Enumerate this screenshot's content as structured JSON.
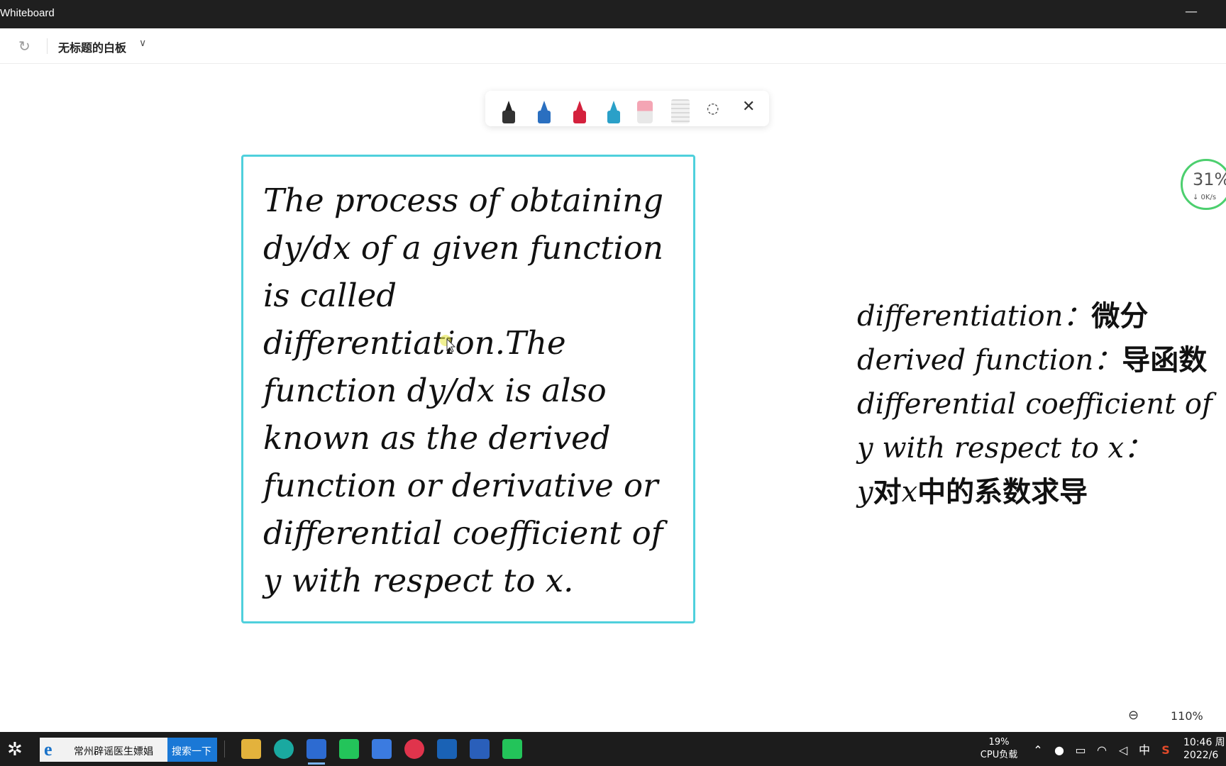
{
  "window": {
    "title": "Whiteboard",
    "minimize": "—"
  },
  "topbar": {
    "doc_title": "无标题的白板",
    "redo_glyph": "↻",
    "chevron": "∨"
  },
  "toolbar": {
    "pens": [
      {
        "name": "black-pen",
        "color": "#222222"
      },
      {
        "name": "blue-pen",
        "color": "#2a6fc0"
      },
      {
        "name": "red-pen",
        "color": "#d4213d"
      },
      {
        "name": "highlighter",
        "color": "#2aa0c8"
      }
    ],
    "lasso_glyph": "◌",
    "close_glyph": "✕"
  },
  "card": {
    "text": "The process of obtaining dy/dx of a given function is called differentiation.The function dy/dx is also known as the derived function or derivative or differential coefficient of y with respect to x."
  },
  "notes": {
    "line1_en": "differentiation：",
    "line1_zh": "微分",
    "line2_en": "derived function：",
    "line2_zh": "导函数",
    "line3": "differential coefficient of",
    "line4": "y with respect to x：",
    "line5_y": "y",
    "line5_zh_a": "对",
    "line5_x": "x",
    "line5_zh_b": "中的系数求导"
  },
  "speed_widget": {
    "percent": "31%",
    "rate": "↓ 0K/s"
  },
  "zoom": {
    "icon": "⊖",
    "value": "110%"
  },
  "taskbar": {
    "search_text": "常州辟谣医生嫖娼",
    "search_button": "搜索一下",
    "cpu_percent": "19%",
    "cpu_label": "CPU负载",
    "ime": "中",
    "time": "10:46 周",
    "date": "2022/6"
  }
}
